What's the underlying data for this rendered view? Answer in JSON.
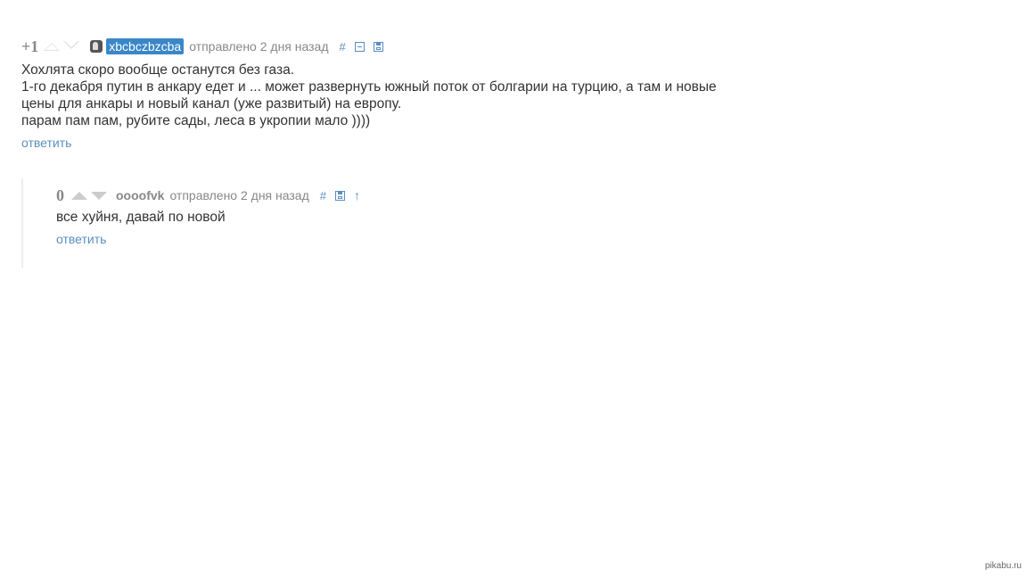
{
  "comments": [
    {
      "rating": "+1",
      "username": "xbcbczbzcba",
      "sent": "отправлено 2 дня назад",
      "hash": "#",
      "lines": [
        "Хохлята скоро вообще останутся без газа.",
        "1-го декабря путин в анкару едет и ... может развернуть южный поток от болгарии на турцию, а там и новые",
        "цены для анкары и новый канал (уже развитый) на европу.",
        "парам пам пам, рубите сады, леса в укропии мало ))))"
      ],
      "reply_label": "ответить"
    },
    {
      "rating": "0",
      "username": "oooofvk",
      "sent": "отправлено 2 дня назад",
      "hash": "#",
      "arrow": "↑",
      "lines": [
        "все хуйня, давай по новой"
      ],
      "reply_label": "ответить"
    }
  ],
  "watermark": "pikabu.ru",
  "colors": {
    "link": "#5a8fc0",
    "username_highlight_bg": "#3a87c8",
    "text": "#333333",
    "meta": "#888888"
  }
}
